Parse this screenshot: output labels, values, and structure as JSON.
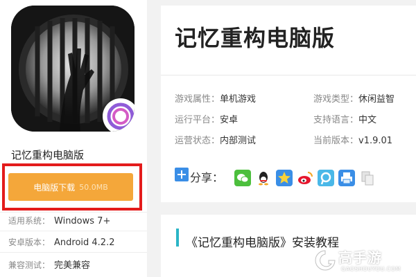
{
  "app": {
    "name": "记忆重构电脑版",
    "download_label": "电脑版下载",
    "download_size": "50.0MB"
  },
  "specs": [
    {
      "label": "适用系统：",
      "value": "Windows 7+"
    },
    {
      "label": "安卓版本：",
      "value": "Android 4.2.2"
    },
    {
      "label": "兼容测试：",
      "value": "完美兼容"
    }
  ],
  "info": {
    "title": "记忆重构电脑版",
    "attributes": [
      {
        "key": "游戏属性：",
        "value": "单机游戏"
      },
      {
        "key": "游戏类型：",
        "value": "休闲益智"
      },
      {
        "key": "运行平台：",
        "value": "安卓"
      },
      {
        "key": "支持语言：",
        "value": "中文"
      },
      {
        "key": "运营状态：",
        "value": "内部测试"
      },
      {
        "key": "当前版本：",
        "value": "v1.9.01"
      }
    ],
    "share_label": "分享：",
    "share_icons": [
      "wechat-icon",
      "qq-icon",
      "qzone-icon",
      "weibo-icon",
      "tencent-weibo-icon",
      "print-icon",
      "copy-icon"
    ]
  },
  "tutorial": {
    "title": "《记忆重构电脑版》安装教程"
  },
  "watermark": {
    "brand": "高手游",
    "domain": "GAOSHOUYOU.COM"
  },
  "colors": {
    "download_button": "#f4a73a",
    "highlight_frame": "#e31b1b",
    "accent_bar": "#2bb5c6"
  }
}
